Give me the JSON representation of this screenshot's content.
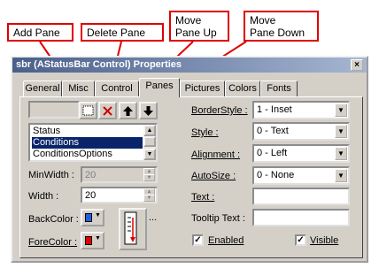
{
  "callouts": {
    "add_pane": "Add Pane",
    "delete_pane": "Delete Pane",
    "move_pane_up_1": "Move",
    "move_pane_up_2": "Pane Up",
    "move_pane_down_1": "Move",
    "move_pane_down_2": "Pane Down"
  },
  "window": {
    "title": "sbr (AStatusBar Control) Properties",
    "close_glyph": "×"
  },
  "tabs": [
    "General",
    "Misc",
    "Control",
    "Panes",
    "Pictures",
    "Colors",
    "Fonts"
  ],
  "active_tab": "Panes",
  "pane_list": {
    "items": [
      "Status",
      "Conditions",
      "ConditionsOptions"
    ],
    "selected": "Conditions"
  },
  "fields": {
    "min_width_label": "MinWidth :",
    "min_width_value": "20",
    "width_label": "Width :",
    "width_value": "20",
    "back_color_label": "BackColor :",
    "fore_color_label": "ForeColor :",
    "border_style_label": "BorderStyle :",
    "border_style_value": "1 - Inset",
    "style_label": "Style :",
    "style_value": "0 - Text",
    "alignment_label": "Alignment :",
    "alignment_value": "0 - Left",
    "autosize_label": "AutoSize :",
    "autosize_value": "0 - None",
    "text_label": "Text :",
    "text_value": "",
    "tooltip_label": "Tooltip Text :",
    "tooltip_value": "",
    "enabled_label": "Enabled",
    "visible_label": "Visible"
  },
  "colors": {
    "back_color": "#2060e0",
    "fore_color": "#e00000",
    "callout_border": "#e00000",
    "title_gradient_start": "#4a5f8a",
    "selection": "#0a246a"
  },
  "icons": {
    "add": "add-pane-icon",
    "delete": "delete-pane-icon",
    "up": "arrow-up-icon",
    "down": "arrow-down-icon",
    "dropdown": "chevron-down-icon",
    "check": "checkmark-icon"
  },
  "misc": {
    "picture_ellipsis": "...",
    "check_glyph": "✓",
    "dd_glyph": "▼",
    "up_glyph": "▲",
    "down_glyph": "▼"
  }
}
